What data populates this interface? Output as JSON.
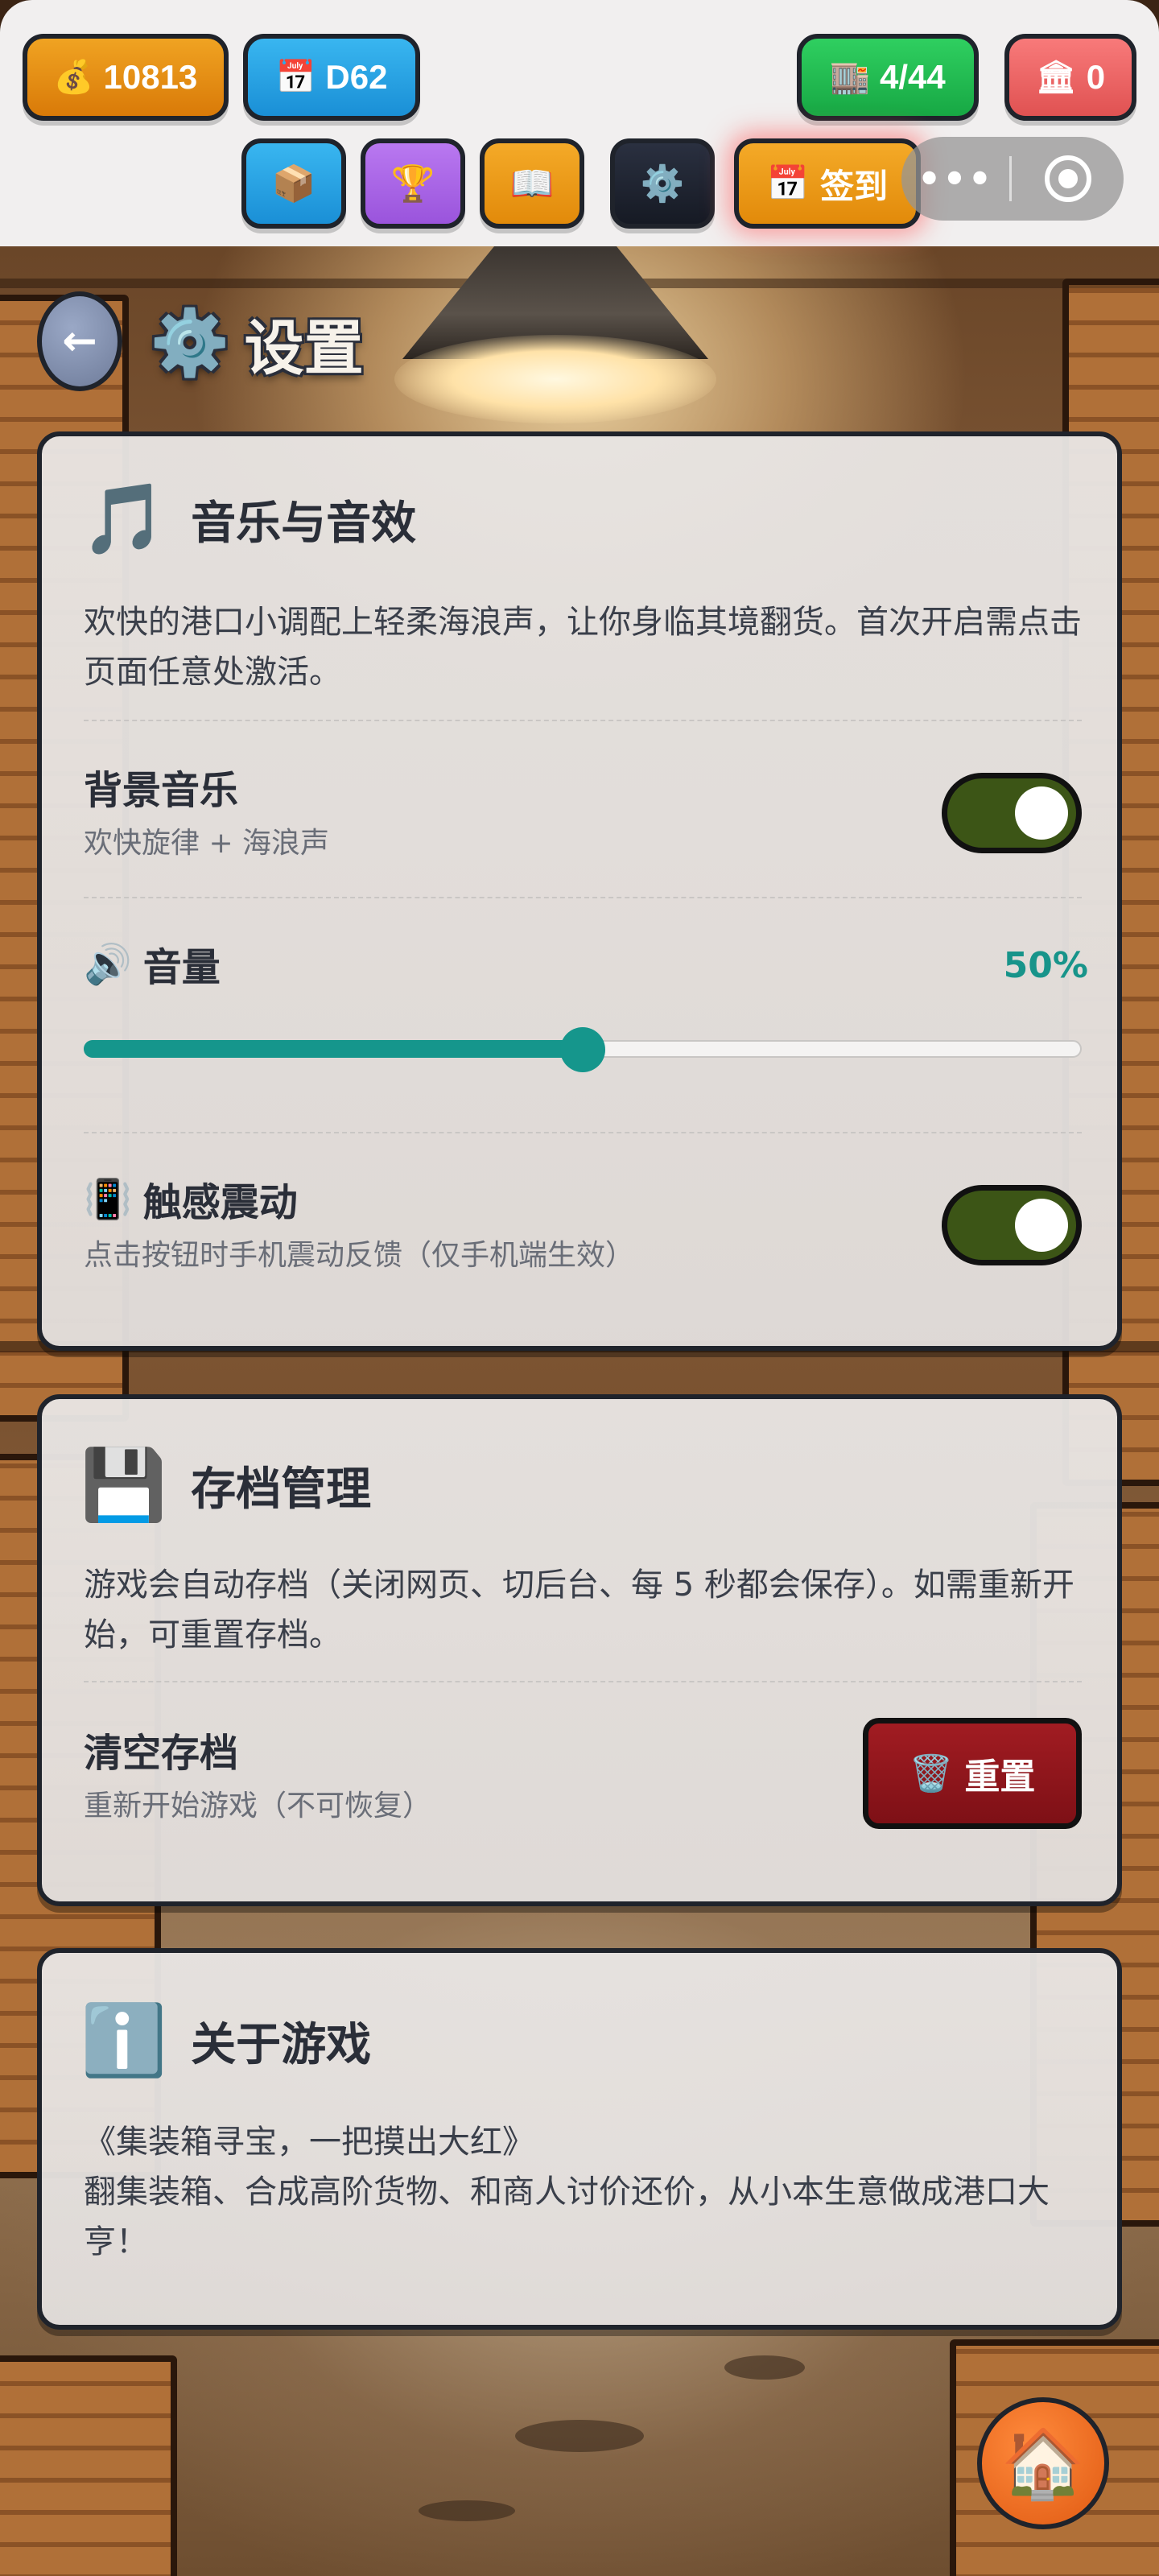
{
  "topbar": {
    "coins": {
      "icon": "💰",
      "value": "10813"
    },
    "day": {
      "icon": "📅",
      "value": "D62"
    },
    "containers": {
      "icon": "🏬",
      "value": "4/44"
    },
    "bank": {
      "icon": "🏛",
      "value": "0"
    },
    "buttons": {
      "box_icon": "📦",
      "trophy_icon": "🏆",
      "book_icon": "📖",
      "gear_icon": "⚙️"
    },
    "checkin": {
      "icon": "📅",
      "label": "签到"
    },
    "capsule": {
      "more": "•••"
    }
  },
  "header": {
    "back_arrow": "←",
    "icon": "⚙️",
    "title": "设置"
  },
  "audio": {
    "icon": "🎵",
    "title": "音乐与音效",
    "desc": "欢快的港口小调配上轻柔海浪声，让你身临其境翻货。首次开启需点击页面任意处激活。",
    "bgm": {
      "title": "背景音乐",
      "sub": "欢快旋律 + 海浪声",
      "on": true
    },
    "volume": {
      "icon": "🔊",
      "title": "音量",
      "percent_label": "50%",
      "value": 0.5
    },
    "haptic": {
      "icon": "📳",
      "title": "触感震动",
      "sub": "点击按钮时手机震动反馈（仅手机端生效）",
      "on": true
    }
  },
  "save": {
    "icon": "💾",
    "title": "存档管理",
    "desc": "游戏会自动存档（关闭网页、切后台、每 5 秒都会保存）。如需重新开始，可重置存档。",
    "clear": {
      "title": "清空存档",
      "sub": "重新开始游戏（不可恢复）",
      "button_icon": "🗑️",
      "button_label": "重置"
    }
  },
  "about": {
    "icon": "ℹ️",
    "title": "关于游戏",
    "line1": "《集装箱寻宝，一把摸出大红》",
    "line2": "翻集装箱、合成高阶货物、和商人讨价还价，从小本生意做成港口大亨！"
  },
  "home": {
    "icon": "🏠"
  },
  "colors": {
    "accent_teal": "#15968c",
    "toggle_on": "#3c5516",
    "danger": "#8e1419"
  }
}
